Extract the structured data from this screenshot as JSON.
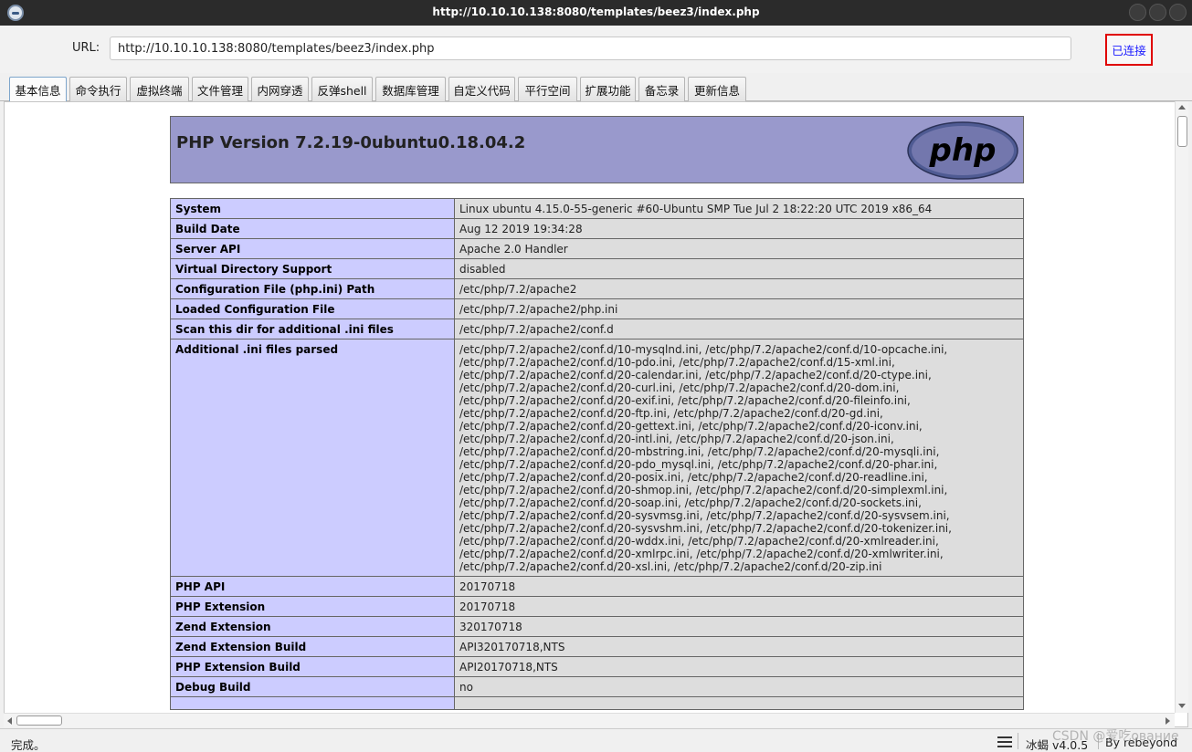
{
  "window": {
    "title": "http://10.10.10.138:8080/templates/beez3/index.php"
  },
  "url_bar": {
    "label": "URL:",
    "value": "http://10.10.10.138:8080/templates/beez3/index.php",
    "status": "已连接",
    "status_color": "#1a1aff",
    "status_border_color": "#e00000"
  },
  "tabs": [
    {
      "label": "基本信息",
      "active": true
    },
    {
      "label": "命令执行"
    },
    {
      "label": "虚拟终端"
    },
    {
      "label": "文件管理"
    },
    {
      "label": "内网穿透"
    },
    {
      "label": "反弹shell"
    },
    {
      "label": "数据库管理"
    },
    {
      "label": "自定义代码"
    },
    {
      "label": "平行空间"
    },
    {
      "label": "扩展功能"
    },
    {
      "label": "备忘录"
    },
    {
      "label": "更新信息"
    }
  ],
  "phpinfo": {
    "header_title": "PHP Version 7.2.19-0ubuntu0.18.04.2",
    "logo_text": "php",
    "header_color": "#9999cc",
    "rows": [
      {
        "key": "System",
        "value": "Linux ubuntu 4.15.0-55-generic #60-Ubuntu SMP Tue Jul 2 18:22:20 UTC 2019 x86_64"
      },
      {
        "key": "Build Date",
        "value": "Aug 12 2019 19:34:28"
      },
      {
        "key": "Server API",
        "value": "Apache 2.0 Handler"
      },
      {
        "key": "Virtual Directory Support",
        "value": "disabled"
      },
      {
        "key": "Configuration File (php.ini) Path",
        "value": "/etc/php/7.2/apache2"
      },
      {
        "key": "Loaded Configuration File",
        "value": "/etc/php/7.2/apache2/php.ini"
      },
      {
        "key": "Scan this dir for additional .ini files",
        "value": "/etc/php/7.2/apache2/conf.d"
      },
      {
        "key": "Additional .ini files parsed",
        "lines": [
          "/etc/php/7.2/apache2/conf.d/10-mysqlnd.ini, /etc/php/7.2/apache2/conf.d/10-opcache.ini,",
          "/etc/php/7.2/apache2/conf.d/10-pdo.ini, /etc/php/7.2/apache2/conf.d/15-xml.ini,",
          "/etc/php/7.2/apache2/conf.d/20-calendar.ini, /etc/php/7.2/apache2/conf.d/20-ctype.ini,",
          "/etc/php/7.2/apache2/conf.d/20-curl.ini, /etc/php/7.2/apache2/conf.d/20-dom.ini,",
          "/etc/php/7.2/apache2/conf.d/20-exif.ini, /etc/php/7.2/apache2/conf.d/20-fileinfo.ini,",
          "/etc/php/7.2/apache2/conf.d/20-ftp.ini, /etc/php/7.2/apache2/conf.d/20-gd.ini,",
          "/etc/php/7.2/apache2/conf.d/20-gettext.ini, /etc/php/7.2/apache2/conf.d/20-iconv.ini,",
          "/etc/php/7.2/apache2/conf.d/20-intl.ini, /etc/php/7.2/apache2/conf.d/20-json.ini,",
          "/etc/php/7.2/apache2/conf.d/20-mbstring.ini, /etc/php/7.2/apache2/conf.d/20-mysqli.ini,",
          "/etc/php/7.2/apache2/conf.d/20-pdo_mysql.ini, /etc/php/7.2/apache2/conf.d/20-phar.ini,",
          "/etc/php/7.2/apache2/conf.d/20-posix.ini, /etc/php/7.2/apache2/conf.d/20-readline.ini,",
          "/etc/php/7.2/apache2/conf.d/20-shmop.ini, /etc/php/7.2/apache2/conf.d/20-simplexml.ini,",
          "/etc/php/7.2/apache2/conf.d/20-soap.ini, /etc/php/7.2/apache2/conf.d/20-sockets.ini,",
          "/etc/php/7.2/apache2/conf.d/20-sysvmsg.ini, /etc/php/7.2/apache2/conf.d/20-sysvsem.ini,",
          "/etc/php/7.2/apache2/conf.d/20-sysvshm.ini, /etc/php/7.2/apache2/conf.d/20-tokenizer.ini,",
          "/etc/php/7.2/apache2/conf.d/20-wddx.ini, /etc/php/7.2/apache2/conf.d/20-xmlreader.ini,",
          "/etc/php/7.2/apache2/conf.d/20-xmlrpc.ini, /etc/php/7.2/apache2/conf.d/20-xmlwriter.ini,",
          "/etc/php/7.2/apache2/conf.d/20-xsl.ini, /etc/php/7.2/apache2/conf.d/20-zip.ini"
        ]
      },
      {
        "key": "PHP API",
        "value": "20170718"
      },
      {
        "key": "PHP Extension",
        "value": "20170718"
      },
      {
        "key": "Zend Extension",
        "value": "320170718"
      },
      {
        "key": "Zend Extension Build",
        "value": "API320170718,NTS"
      },
      {
        "key": "PHP Extension Build",
        "value": "API20170718,NTS"
      },
      {
        "key": "Debug Build",
        "value": "no"
      },
      {
        "key": "",
        "value": ""
      }
    ]
  },
  "statusbar": {
    "status_text": "完成。",
    "version": "冰蝎 v4.0.5",
    "author": "By rebeyond",
    "watermark": "CSDN @爱吃ование"
  }
}
